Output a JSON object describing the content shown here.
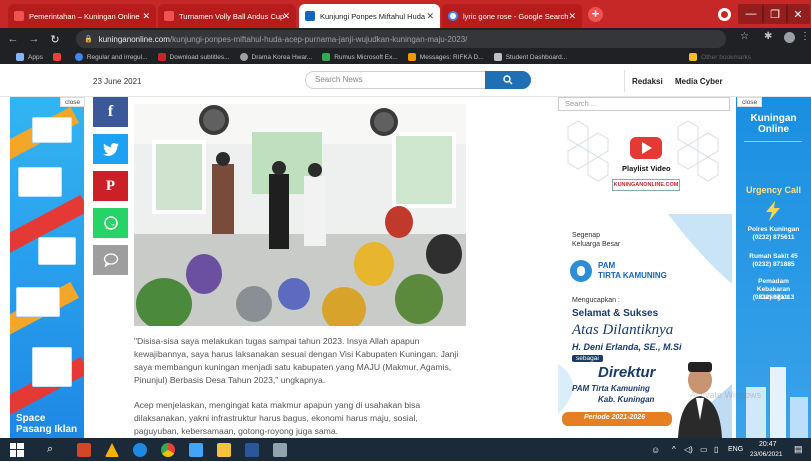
{
  "browser": {
    "tabs": [
      {
        "label": "Pemerintahan – Kuningan Online",
        "favicon_color": "#c62828",
        "active": false
      },
      {
        "label": "Turnamen Volly Ball Andus Cup",
        "favicon_color": "#c62828",
        "active": false
      },
      {
        "label": "Kunjungi Ponpes Miftahul Huda",
        "favicon_color": "#1565c0",
        "active": true
      },
      {
        "label": "lyric gone rose - Google Search",
        "favicon_color": "#4285f4",
        "active": false
      }
    ],
    "new_tab_icon": "plus-icon",
    "url_domain": "kuninganonline.com",
    "url_path": "/kunjungi-ponpes-miftahul-huda-acep-purnama-janji-wujudkan-kuningan-maju-2023/",
    "bookmarks": [
      {
        "label": "Apps",
        "color": "#8ab4f8"
      },
      {
        "label": "",
        "color": "#ea4335"
      },
      {
        "label": "Regular and irregul...",
        "color": "#4285f4"
      },
      {
        "label": "Download subtitles...",
        "color": "#c62828"
      },
      {
        "label": "Drama Korea Hwar...",
        "color": "#9aa0a6"
      },
      {
        "label": "Rumus Microsoft Ex...",
        "color": "#34a853"
      },
      {
        "label": "Messages: RIFKA D...",
        "color": "#f29900"
      },
      {
        "label": "Student Dashboard...",
        "color": "#bdc1c6"
      },
      {
        "label": "Other bookmarks",
        "color": "#f6c026"
      }
    ]
  },
  "site_header": {
    "date": "23 June 2021",
    "search_placeholder": "Search News",
    "nav_redaksi": "Redaksi",
    "nav_media_cyber": "Media Cyber"
  },
  "left_ad": {
    "close_label": "close",
    "text_line1": "Space",
    "text_line2": "Pasang Iklan"
  },
  "share_buttons": [
    {
      "name": "facebook-share-button",
      "icon": "facebook-icon",
      "glyph": "f",
      "color": "#3b5998"
    },
    {
      "name": "twitter-share-button",
      "icon": "twitter-icon",
      "glyph": "",
      "color": "#1da1f2"
    },
    {
      "name": "pinterest-share-button",
      "icon": "pinterest-icon",
      "glyph": "P",
      "color": "#cb2027"
    },
    {
      "name": "whatsapp-share-button",
      "icon": "whatsapp-icon",
      "glyph": "",
      "color": "#25d366"
    },
    {
      "name": "comment-share-button",
      "icon": "comment-icon",
      "glyph": "",
      "color": "#9e9e9e"
    }
  ],
  "article": {
    "paragraph1": "\"Disisa-sisa saya melakukan tugas sampai tahun 2023. Insya Allah apapun kewajibannya, saya harus laksanakan sesuai dengan Visi Kabupaten Kuningan. Janji saya membangun kuningan menjadi satu kabupaten yang MAJU (Makmur, Agamis, Pinunjul) Berbasis Desa Tahun 2023,\" ungkapnya.",
    "paragraph2": "Acep menjelaskan, mengingat kata makmur apapun yang di usahakan bisa dilaksanakan, yakni infrastruktur harus bagus, ekonomi harus maju, sosial, paguyuban, kebersamaan, gotong-royong juga sama."
  },
  "sidebar": {
    "search_placeholder": "Search ...",
    "playlist_label": "Playlist Video",
    "playlist_logo": "KUNINGANONLINE.COM"
  },
  "pam_ad": {
    "segenap": "Segenap",
    "keluarga": "Keluarga Besar",
    "company_top": "PAM",
    "company": "TIRTA KAMUNING",
    "mengucapkan": "Mengucapkan :",
    "selamat": "Selamat & Sukses",
    "dilantik": "Atas Dilantiknya",
    "person": "H. Deni Erlanda, SE., M.Si",
    "sebagai": "sebagai",
    "direktur": "Direktur",
    "org": "PAM Tirta Kamuning",
    "kab": "Kab. Kuningan",
    "periode": "Periode 2021-2026"
  },
  "right_ad": {
    "close_label": "close",
    "brand_line1": "Kuningan",
    "brand_line2": "Online",
    "urgency": "Urgency Call",
    "contacts": [
      {
        "name": "Polres Kuningan",
        "phone": "(0232) 875611"
      },
      {
        "name": "Rumah Sakit 45",
        "phone": "(0232) 871885"
      },
      {
        "name": "Pemadam Kebakaran Kuningan",
        "phone": "(0232) 871113"
      }
    ]
  },
  "taskbar": {
    "lang": "ENG",
    "time": "20:47",
    "date": "23/06/2021"
  },
  "watermark": "Activate Windows"
}
